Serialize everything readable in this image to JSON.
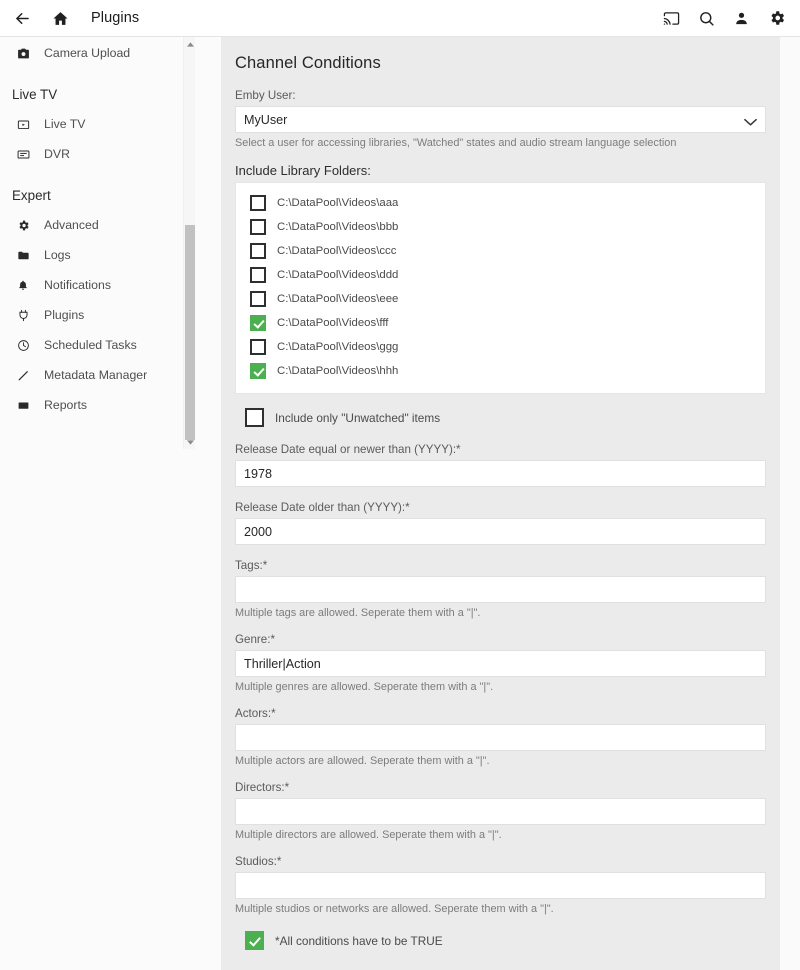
{
  "topbar": {
    "back_icon": "arrow-back-icon",
    "home_icon": "home-icon",
    "title": "Plugins",
    "right_icons": [
      {
        "name": "cast-icon"
      },
      {
        "name": "search-icon"
      },
      {
        "name": "person-icon"
      },
      {
        "name": "gear-icon"
      }
    ]
  },
  "sidebar": {
    "top_items": [
      {
        "label": "Camera Upload",
        "icon": "camera-icon"
      }
    ],
    "sections": [
      {
        "header": "Live TV",
        "items": [
          {
            "label": "Live TV",
            "icon": "tv-icon"
          },
          {
            "label": "DVR",
            "icon": "dvr-icon"
          }
        ]
      },
      {
        "header": "Expert",
        "items": [
          {
            "label": "Advanced",
            "icon": "gear-icon"
          },
          {
            "label": "Logs",
            "icon": "folder-icon"
          },
          {
            "label": "Notifications",
            "icon": "bell-icon"
          },
          {
            "label": "Plugins",
            "icon": "plugin-icon"
          },
          {
            "label": "Scheduled Tasks",
            "icon": "clock-icon"
          },
          {
            "label": "Metadata Manager",
            "icon": "pencil-icon"
          },
          {
            "label": "Reports",
            "icon": "report-icon"
          }
        ]
      }
    ],
    "scrollbar": {
      "up_arrow_icon": "scroll-up-arrow-icon",
      "down_arrow_icon": "scroll-down-arrow-icon"
    }
  },
  "main": {
    "title": "Channel Conditions",
    "emby_user": {
      "label": "Emby User:",
      "value": "MyUser",
      "help": "Select a user for accessing libraries, \"Watched\" states and audio stream language selection",
      "chevron_icon": "chevron-down-icon"
    },
    "library_folders": {
      "label": "Include Library Folders:",
      "items": [
        {
          "path": "C:\\DataPool\\Videos\\aaa",
          "checked": false
        },
        {
          "path": "C:\\DataPool\\Videos\\bbb",
          "checked": false
        },
        {
          "path": "C:\\DataPool\\Videos\\ccc",
          "checked": false
        },
        {
          "path": "C:\\DataPool\\Videos\\ddd",
          "checked": false
        },
        {
          "path": "C:\\DataPool\\Videos\\eee",
          "checked": false
        },
        {
          "path": "C:\\DataPool\\Videos\\fff",
          "checked": true
        },
        {
          "path": "C:\\DataPool\\Videos\\ggg",
          "checked": false
        },
        {
          "path": "C:\\DataPool\\Videos\\hhh",
          "checked": true
        }
      ]
    },
    "unwatched": {
      "label": "Include only \"Unwatched\" items",
      "checked": false
    },
    "release_date_newer": {
      "label": "Release Date equal or newer than (YYYY):*",
      "value": "1978",
      "placeholder": ""
    },
    "release_date_older": {
      "label": "Release Date older than (YYYY):*",
      "value": "2000",
      "placeholder": ""
    },
    "tags": {
      "label": "Tags:*",
      "value": "",
      "placeholder": "",
      "help": "Multiple tags are allowed. Seperate them with a \"|\"."
    },
    "genre": {
      "label": "Genre:*",
      "value": "Thriller|Action",
      "placeholder": "",
      "help": "Multiple genres are allowed. Seperate them with a \"|\"."
    },
    "actors": {
      "label": "Actors:*",
      "value": "",
      "placeholder": "",
      "help": "Multiple actors are allowed. Seperate them with a \"|\"."
    },
    "directors": {
      "label": "Directors:*",
      "value": "",
      "placeholder": "",
      "help": "Multiple directors are allowed. Seperate them with a \"|\"."
    },
    "studios": {
      "label": "Studios:*",
      "value": "",
      "placeholder": "",
      "help": "Multiple studios or networks are allowed. Seperate them with a \"|\"."
    },
    "all_conditions": {
      "label": "*All conditions have to be TRUE",
      "checked": true
    }
  },
  "colors": {
    "accent_green": "#4caf50",
    "content_bg": "#ebebeb",
    "sidebar_bg": "#fbfbfb",
    "text_dark": "#272727"
  }
}
